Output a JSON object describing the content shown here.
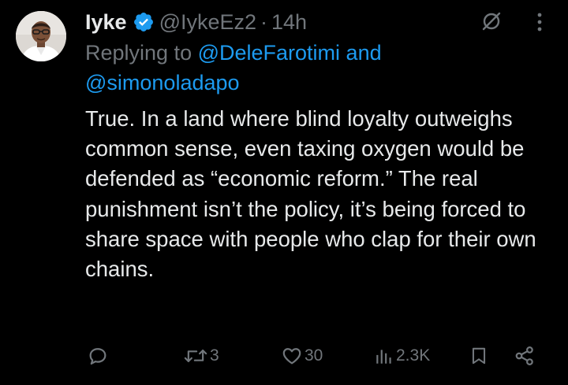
{
  "tweet": {
    "display_name": "Iyke",
    "handle": "@IykeEz2",
    "separator": "·",
    "time": "14h",
    "replying_prefix": "Replying to ",
    "reply_to_1": "@DeleFarotimi",
    "reply_joiner": " and ",
    "reply_to_2": "@simonoladapo",
    "body": "True. In a land where blind loyalty outweighs common sense, even taxing oxygen would be defended as “economic reform.” The real punishment isn’t the policy, it’s being forced to share space with people who clap for their own chains."
  },
  "actions": {
    "reply_count": "",
    "retweet_count": "3",
    "like_count": "30",
    "views_count": "2.3K"
  },
  "icons": {
    "verified": "verified-badge-icon",
    "grok": "grok-icon",
    "more": "more-vertical-icon",
    "reply": "reply-bubble-icon",
    "retweet": "retweet-icon",
    "like": "heart-icon",
    "views": "views-bar-chart-icon",
    "bookmark": "bookmark-icon",
    "share": "share-icon"
  },
  "colors": {
    "background": "#000000",
    "text_primary": "#e7e9ea",
    "text_secondary": "#71767b",
    "link": "#1d9bf0",
    "verified": "#1d9bf0"
  }
}
